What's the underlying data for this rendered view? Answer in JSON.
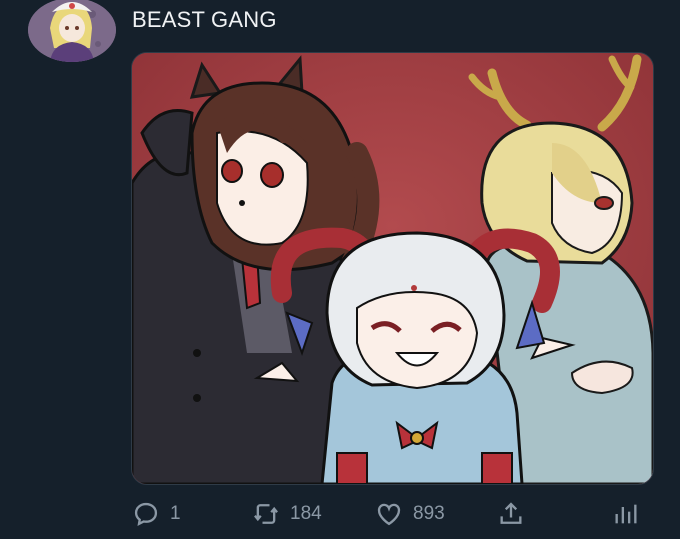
{
  "tweet": {
    "text": "BEAST GANG"
  },
  "media": {
    "alt": "Illustration of three characters: a dark-haired girl in a black suit with horse ears, a pale girl with red ram horns and a sharp-toothed grin, and a blonde girl with antlers, on a red background",
    "background_color": "#9d3a3f"
  },
  "actions": {
    "reply": {
      "icon": "speech-bubble-icon",
      "count": "1"
    },
    "retweet": {
      "icon": "retweet-icon",
      "count": "184"
    },
    "like": {
      "icon": "heart-icon",
      "count": "893"
    },
    "share": {
      "icon": "share-icon"
    },
    "stats": {
      "icon": "bar-chart-icon"
    }
  },
  "colors": {
    "background": "#15202b",
    "text": "#e7e9ea",
    "muted": "#8b98a5"
  }
}
